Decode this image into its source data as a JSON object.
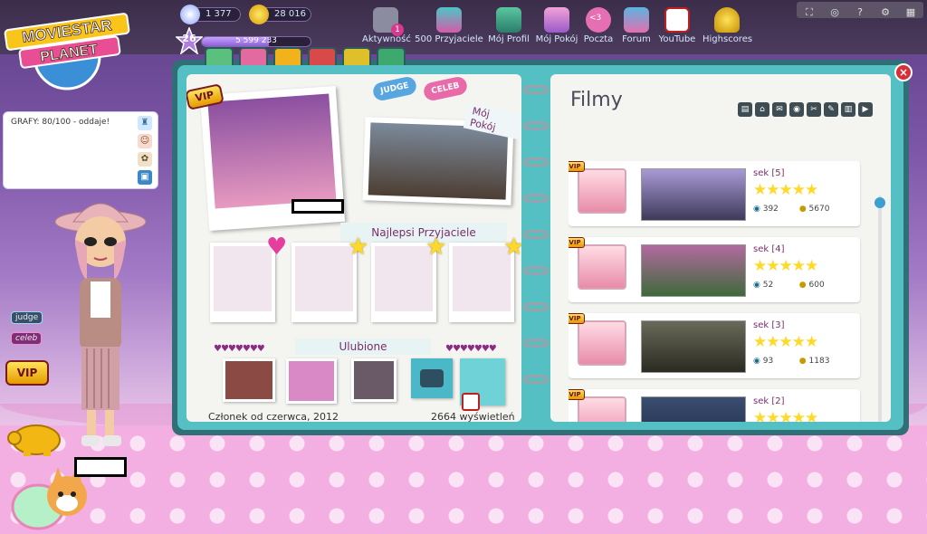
{
  "stats": {
    "diamonds": "1 377",
    "starcoins": "28 016",
    "level": "26",
    "fame": "5 599 233",
    "fame_progress": 0.62
  },
  "nav": [
    {
      "label": "Aktywność",
      "icon": "activity-icon",
      "badge": "1"
    },
    {
      "label": "500 Przyjaciele",
      "icon": "friends-icon"
    },
    {
      "label": "Mój Profil",
      "icon": "profile-icon"
    },
    {
      "label": "Mój Pokój",
      "icon": "room-icon"
    },
    {
      "label": "Poczta",
      "icon": "mail-icon",
      "badge": "<3"
    },
    {
      "label": "Forum",
      "icon": "forum-icon"
    },
    {
      "label": "YouTube",
      "icon": "youtube-icon"
    },
    {
      "label": "Highscores",
      "icon": "trophy-icon"
    }
  ],
  "logo": {
    "line1": "MOVIESTAR",
    "line2": "PLANET"
  },
  "chat": {
    "text": "GRAFY: 80/100 - oddaje!"
  },
  "left_badges": {
    "judge": "judge",
    "celeb": "celeb",
    "vip": "VIP"
  },
  "book": {
    "vip": "VIP",
    "clips": {
      "judge": "JUDGE",
      "celeb": "CELEB"
    },
    "room_label": "Mój Pokój",
    "best_friends_label": "Najlepsi Przyjaciele",
    "favorites_label": "Ulubione",
    "member_since": "Członek od czerwca, 2012",
    "views": "2664 wyświetleń"
  },
  "movies_page": {
    "title": "Filmy",
    "movies": [
      {
        "name": "sek [5]",
        "rating": 5,
        "views": "392",
        "coins": "5670"
      },
      {
        "name": "sek [4]",
        "rating": 5,
        "views": "52",
        "coins": "600"
      },
      {
        "name": "sek [3]",
        "rating": 5,
        "views": "93",
        "coins": "1183"
      },
      {
        "name": "sek [2]",
        "rating": 5,
        "views": "",
        "coins": ""
      }
    ]
  },
  "colors": {
    "accent": "#7a2e6a",
    "teal": "#55c0c4",
    "gold": "#ffd927"
  }
}
